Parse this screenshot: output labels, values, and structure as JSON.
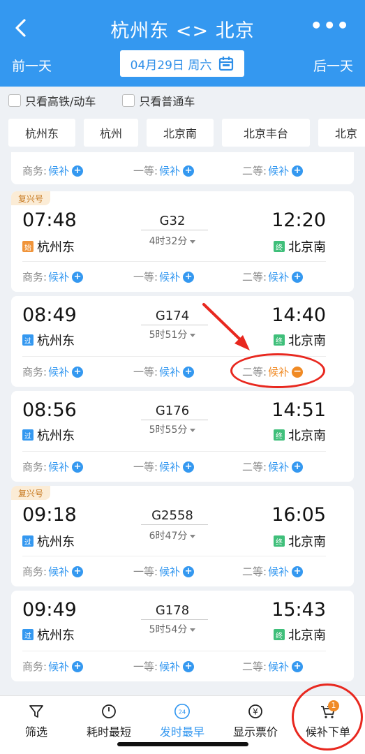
{
  "header": {
    "title": "杭州东 <> 北京",
    "more": "•••",
    "prev_day": "前一天",
    "next_day": "后一天",
    "date": "04月29日 周六"
  },
  "filters": {
    "high_speed": "只看高铁/动车",
    "normal": "只看普通车"
  },
  "stations": [
    "杭州东",
    "杭州",
    "北京南",
    "北京丰台",
    "北京"
  ],
  "partial_row": {
    "business_label": "商务:",
    "first_label": "一等:",
    "second_label": "二等:",
    "value": "候补"
  },
  "trains": [
    {
      "badge": "复兴号",
      "dep_time": "07:48",
      "train_no": "G32",
      "duration": "4时32分",
      "arr_time": "12:20",
      "dep_tag": "始",
      "dep_station": "杭州东",
      "arr_tag": "终",
      "arr_station": "北京南",
      "business_label": "商务:",
      "business": "候补",
      "first_label": "一等:",
      "first": "候补",
      "second_label": "二等:",
      "second": "候补"
    },
    {
      "badge": "",
      "dep_time": "08:49",
      "train_no": "G174",
      "duration": "5时51分",
      "arr_time": "14:40",
      "dep_tag": "过",
      "dep_station": "杭州东",
      "arr_tag": "终",
      "arr_station": "北京南",
      "business_label": "商务:",
      "business": "候补",
      "first_label": "一等:",
      "first": "候补",
      "second_label": "二等:",
      "second": "候补"
    },
    {
      "badge": "",
      "dep_time": "08:56",
      "train_no": "G176",
      "duration": "5时55分",
      "arr_time": "14:51",
      "dep_tag": "过",
      "dep_station": "杭州东",
      "arr_tag": "终",
      "arr_station": "北京南",
      "business_label": "商务:",
      "business": "候补",
      "first_label": "一等:",
      "first": "候补",
      "second_label": "二等:",
      "second": "候补"
    },
    {
      "badge": "复兴号",
      "dep_time": "09:18",
      "train_no": "G2558",
      "duration": "6时47分",
      "arr_time": "16:05",
      "dep_tag": "过",
      "dep_station": "杭州东",
      "arr_tag": "终",
      "arr_station": "北京南",
      "business_label": "商务:",
      "business": "候补",
      "first_label": "一等:",
      "first": "候补",
      "second_label": "二等:",
      "second": "候补"
    },
    {
      "badge": "",
      "dep_time": "09:49",
      "train_no": "G178",
      "duration": "5时54分",
      "arr_time": "15:43",
      "dep_tag": "过",
      "dep_station": "杭州东",
      "arr_tag": "终",
      "arr_station": "北京南",
      "business_label": "商务:",
      "business": "候补",
      "first_label": "一等:",
      "first": "候补",
      "second_label": "二等:",
      "second": "候补"
    }
  ],
  "tabs": {
    "filter": "筛选",
    "shortest": "耗时最短",
    "earliest": "发时最早",
    "earliest_icon_text": "24",
    "price": "显示票价",
    "price_icon_text": "¥",
    "waitlist": "候补下单",
    "waitlist_count": "1"
  },
  "colors": {
    "primary": "#3498f0",
    "accent_orange": "#f08a24",
    "annotation_red": "#e8281f"
  }
}
